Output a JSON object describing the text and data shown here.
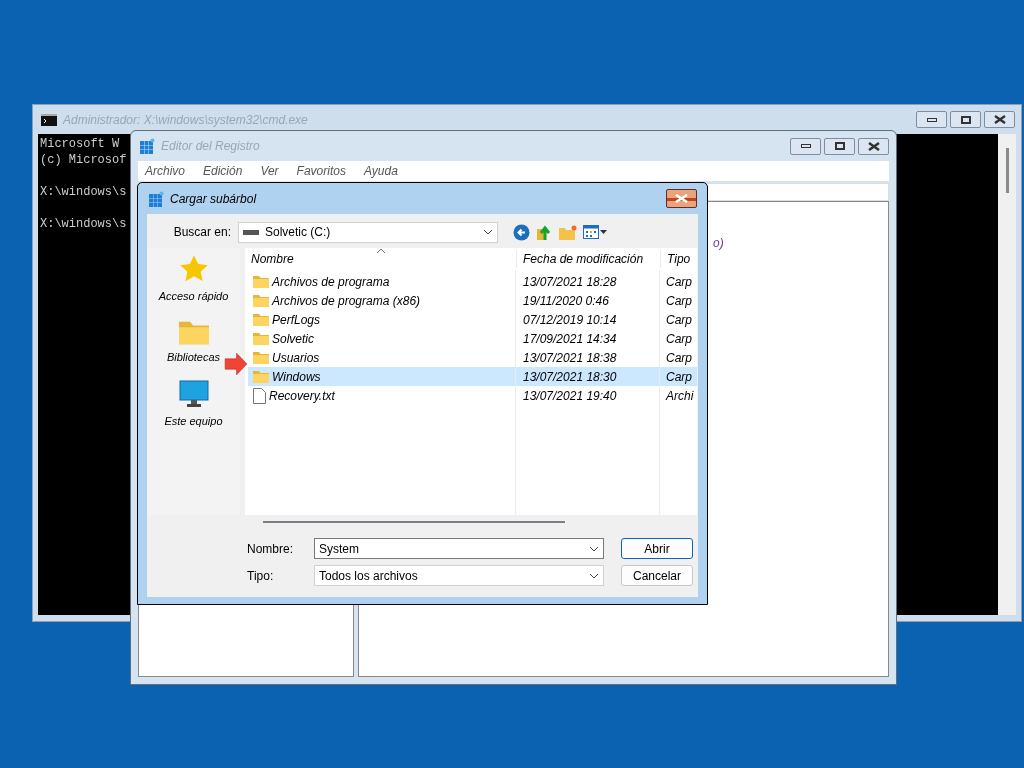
{
  "cmd_window": {
    "title": "Administrador: X:\\windows\\system32\\cmd.exe",
    "console_blocks": [
      [
        "Microsoft W",
        "(c) Microsof"
      ],
      [
        "X:\\windows\\s"
      ],
      [
        "X:\\windows\\s"
      ]
    ]
  },
  "regedit_window": {
    "title": "Editor del Registro",
    "menu": [
      "Archivo",
      "Edición",
      "Ver",
      "Favoritos",
      "Ayuda"
    ],
    "right_pane_text": "o)"
  },
  "dialog": {
    "title": "Cargar subárbol",
    "look_in_label": "Buscar en:",
    "look_in_value": "Solvetic (C:)",
    "places": [
      {
        "label": "Acceso rápido",
        "kind": "star"
      },
      {
        "label": "Bibliotecas",
        "kind": "library"
      },
      {
        "label": "Este equipo",
        "kind": "computer"
      }
    ],
    "columns": [
      "Nombre",
      "Fecha de modificación",
      "Tipo"
    ],
    "rows": [
      {
        "name": "Archivos de programa",
        "date": "13/07/2021 18:28",
        "type": "Carp",
        "kind": "folder",
        "selected": false
      },
      {
        "name": "Archivos de programa (x86)",
        "date": "19/11/2020 0:46",
        "type": "Carp",
        "kind": "folder",
        "selected": false
      },
      {
        "name": "PerfLogs",
        "date": "07/12/2019 10:14",
        "type": "Carp",
        "kind": "folder",
        "selected": false
      },
      {
        "name": "Solvetic",
        "date": "17/09/2021 14:34",
        "type": "Carp",
        "kind": "folder",
        "selected": false
      },
      {
        "name": "Usuarios",
        "date": "13/07/2021 18:38",
        "type": "Carp",
        "kind": "folder",
        "selected": false
      },
      {
        "name": "Windows",
        "date": "13/07/2021 18:30",
        "type": "Carp",
        "kind": "folder",
        "selected": true
      },
      {
        "name": "Recovery.txt",
        "date": "13/07/2021 19:40",
        "type": "Archi",
        "kind": "file",
        "selected": false
      }
    ],
    "filename_label": "Nombre:",
    "filename_value": "System",
    "filetype_label": "Tipo:",
    "filetype_value": "Todos los archivos",
    "buttons": [
      {
        "label": "Abrir",
        "default": true
      },
      {
        "label": "Cancelar",
        "default": false
      }
    ]
  }
}
